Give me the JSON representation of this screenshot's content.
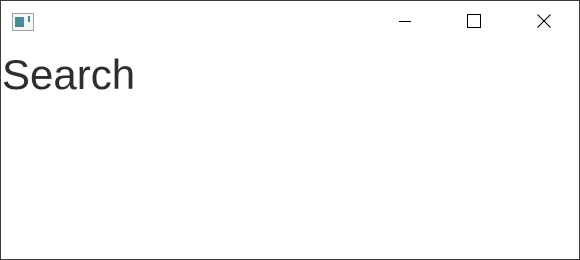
{
  "window": {
    "title": "Search",
    "icon": "app-window-icon",
    "controls": {
      "minimize_icon": "minimize-icon",
      "maximize_icon": "maximize-icon",
      "close_icon": "close-icon"
    }
  },
  "colors": {
    "background": "#ffffff",
    "border": "#3c3c3c",
    "text": "#2e2e2e",
    "icon_teal": "#3f8f8a",
    "icon_blue": "#5a7fb5"
  }
}
